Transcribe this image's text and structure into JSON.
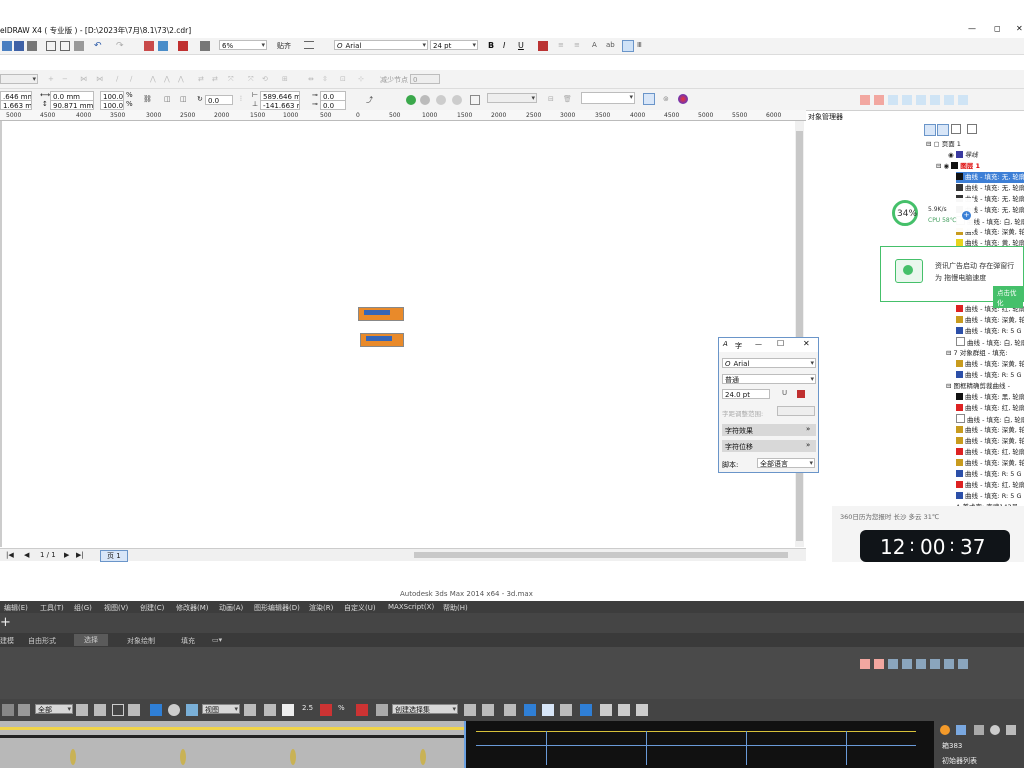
{
  "app": {
    "title": "eIDRAW X4 ( 专业版 ) - [D:\\2023年\\7月\\8.1\\73\\2.cdr]",
    "window_controls": [
      "—",
      "◻",
      "✕"
    ]
  },
  "standard_toolbar": {
    "zoom": "6%",
    "snap_label": "贴齐",
    "font": "Arial",
    "font_size": "24 pt"
  },
  "property_bar_1": {
    "node_label": "减少节点",
    "node_value": "0"
  },
  "property_bar_2": {
    "x": ".646 mm",
    "y": "1.663 mm",
    "w": "0.0 mm",
    "h": "90.871 mm",
    "scale_w": "100.0",
    "scale_h": "100.0",
    "percent": "%",
    "angle": "0.0",
    "pos_x": "589.646 mm",
    "pos_y": "-141.663 mm",
    "off_x": "0.0",
    "off_y": "0.0"
  },
  "ruler": {
    "ticks": [
      "5000",
      "4500",
      "4000",
      "3500",
      "3000",
      "2500",
      "2000",
      "1500",
      "1000",
      "500",
      "0",
      "500",
      "1000",
      "1500",
      "2000",
      "2500",
      "3000",
      "3500",
      "4000",
      "4500",
      "5000",
      "5500",
      "6000",
      "6500"
    ]
  },
  "page_nav": {
    "counter": "1 / 1",
    "page_tab": "页 1"
  },
  "object_manager": {
    "title": "对象管理器",
    "page": "页面 1",
    "layers": [
      "导线",
      "图层 1"
    ],
    "rows": [
      "曲线 - 填充: 无, 轮廓",
      "曲线 - 填充: 无, 轮廓",
      "曲线 - 填充: 无, 轮廓",
      "曲线 - 填充: 无, 轮廓",
      "曲线 - 填充: 白, 轮廓",
      "曲线 - 填充: 深黄, 轮",
      "曲线 - 填充: 黄, 轮廓"
    ],
    "rows_lower": [
      "曲线 - 填充: 红, 轮廓",
      "曲线 - 填充: 深黄, 轮",
      "曲线 - 填充: R: 5 G",
      "曲线 - 填充: 白, 轮廓",
      "7 对象群组 - 填充:",
      "曲线 - 填充: 深黄, 轮",
      "曲线 - 填充: R: 5 G",
      "图框精确剪裁曲线 -",
      "曲线 - 填充: 黑, 轮廓",
      "曲线 - 填充: 红, 轮廓",
      "曲线 - 填充: 白, 轮廓",
      "曲线 - 填充: 深黄, 轮",
      "曲线 - 填充: 深黄, 轮",
      "曲线 - 填充: 红, 轮廓",
      "曲线 - 填充: 深黄, 轮",
      "曲线 - 填充: R: 5 G",
      "曲线 - 填充: 红, 轮廓",
      "曲线 - 填充: R: 5 G",
      "美术字: 字魂143号"
    ]
  },
  "cpu_widget": {
    "percent": "34%",
    "speed": "5.9K/s",
    "cpu": "CPU 58℃"
  },
  "ad_popup": {
    "line1": "资讯广告启动 存在弹窗行",
    "line2": "为 拖慢电脑速度",
    "button": "点击优化"
  },
  "char_panel": {
    "title": "字",
    "font": "Arial",
    "style": "普通",
    "size": "24.0 pt",
    "spacing_label": "字距调整范围:",
    "effects": "字符效果",
    "offset": "字符位移",
    "script_label": "脚本:",
    "script_value": "全部语言"
  },
  "clock_widget": {
    "weather": "360日历为您报时 长沙 多云 31℃",
    "hour": "12",
    "minute": "00",
    "second": "37"
  },
  "max": {
    "title": "Autodesk 3ds Max 2014 x64 - 3d.max",
    "menu": [
      "编辑(E)",
      "工具(T)",
      "组(G)",
      "视图(V)",
      "创建(C)",
      "修改器(M)",
      "动画(A)",
      "图形编辑器(D)",
      "渲染(R)",
      "自定义(U)",
      "MAXScript(X)",
      "帮助(H)"
    ],
    "ribbon_tabs": [
      "建模",
      "自由形式",
      "选择",
      "对象绘制",
      "填充"
    ],
    "filter": "全部",
    "view": "视图",
    "selset": "创建选择集",
    "obj_count": "箱383",
    "obj_list": "初始器列表"
  }
}
